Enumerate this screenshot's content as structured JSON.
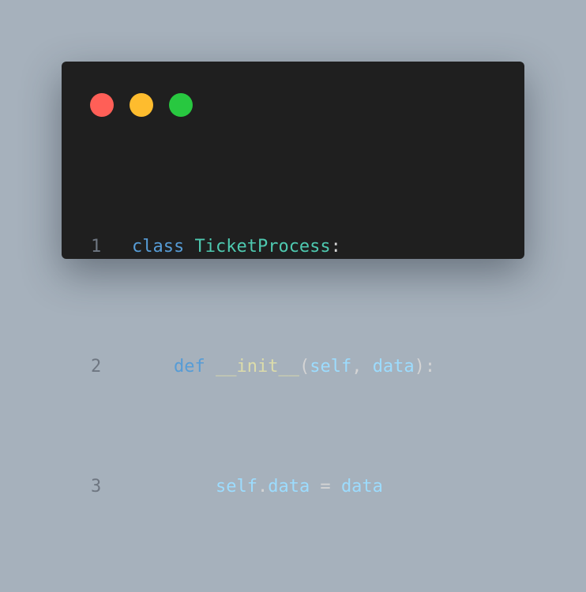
{
  "window": {
    "buttons": [
      {
        "name": "close",
        "color": "#ff5f57"
      },
      {
        "name": "minimize",
        "color": "#febc2e"
      },
      {
        "name": "zoom",
        "color": "#28c840"
      }
    ]
  },
  "code": {
    "language": "python",
    "lines": [
      {
        "number": "1",
        "indent": "",
        "tokens": [
          {
            "text": "class",
            "kind": "keyword"
          },
          {
            "text": " ",
            "kind": "space"
          },
          {
            "text": "TicketProcess",
            "kind": "class-name"
          },
          {
            "text": ":",
            "kind": "punct"
          }
        ]
      },
      {
        "number": "2",
        "indent": "    ",
        "tokens": [
          {
            "text": "def",
            "kind": "keyword"
          },
          {
            "text": " ",
            "kind": "space"
          },
          {
            "text": "__init__",
            "kind": "function"
          },
          {
            "text": "(",
            "kind": "punct"
          },
          {
            "text": "self",
            "kind": "variable"
          },
          {
            "text": ", ",
            "kind": "punct"
          },
          {
            "text": "data",
            "kind": "variable"
          },
          {
            "text": "):",
            "kind": "punct"
          }
        ]
      },
      {
        "number": "3",
        "indent": "        ",
        "tokens": [
          {
            "text": "self",
            "kind": "variable"
          },
          {
            "text": ".",
            "kind": "punct"
          },
          {
            "text": "data",
            "kind": "variable"
          },
          {
            "text": " = ",
            "kind": "punct"
          },
          {
            "text": "data",
            "kind": "variable"
          }
        ]
      }
    ]
  },
  "colors": {
    "background": "#a6b1bc",
    "editor": "#1f1f1f",
    "line_number": "#6e7681",
    "keyword": "#569cd6",
    "class_name": "#4ec9b0",
    "function": "#dcdcaa",
    "variable": "#9cdcfe",
    "punctuation": "#d4d4d4"
  }
}
